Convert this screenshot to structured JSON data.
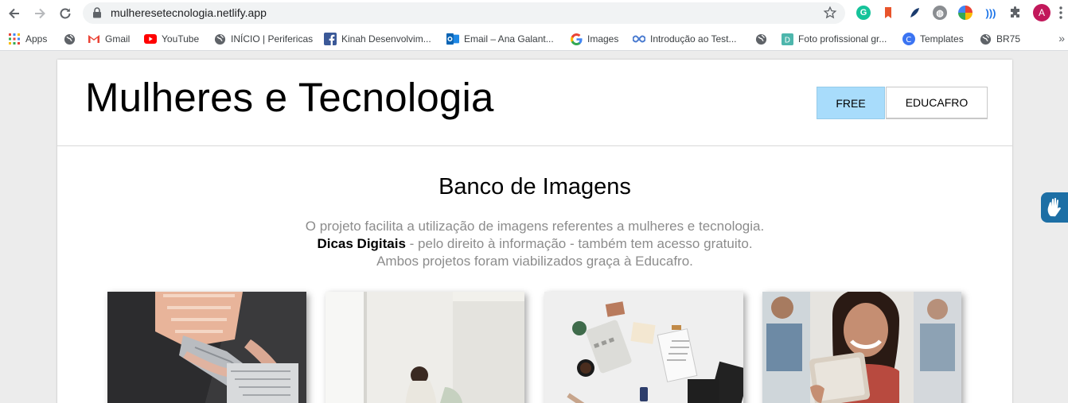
{
  "browser": {
    "url": "mulheresetecnologia.netlify.app",
    "profile_initial": "A",
    "bookmarks": [
      {
        "label": "Apps",
        "icon": "apps-grid-icon"
      },
      {
        "label": "",
        "icon": "globe-icon"
      },
      {
        "label": "Gmail",
        "icon": "gmail-icon"
      },
      {
        "label": "YouTube",
        "icon": "youtube-icon"
      },
      {
        "label": "INÍCIO | Perifericas",
        "icon": "globe-icon"
      },
      {
        "label": "Kinah Desenvolvim...",
        "icon": "facebook-icon"
      },
      {
        "label": "Email – Ana Galant...",
        "icon": "outlook-icon"
      },
      {
        "label": "Images",
        "icon": "google-icon"
      },
      {
        "label": "Introdução ao Test...",
        "icon": "infinity-icon"
      },
      {
        "label": "",
        "icon": "globe-icon"
      },
      {
        "label": "Foto profissional gr...",
        "icon": "doc-icon"
      },
      {
        "label": "Templates",
        "icon": "canva-icon"
      },
      {
        "label": "BR75",
        "icon": "globe-icon"
      }
    ],
    "more_bookmarks": "»"
  },
  "site": {
    "title": "Mulheres e Tecnologia",
    "nav": {
      "free": "FREE",
      "educafro": "EDUCAFRO"
    }
  },
  "main": {
    "heading": "Banco de Imagens",
    "line1": "O projeto facilita a utilização de imagens referentes a mulheres e tecnologia.",
    "line2_bold": "Dicas Digitais",
    "line2_rest": " - pelo direito à informação - também tem acesso gratuito.",
    "line3": "Ambos projetos foram viabilizados graça à Educafro."
  },
  "gallery": [
    {
      "name": "woman-typing-laptop-photo"
    },
    {
      "name": "woman-sitting-room-photo"
    },
    {
      "name": "office-desk-flatlay-photo"
    },
    {
      "name": "smiling-woman-tablet-photo"
    }
  ],
  "colors": {
    "free_button": "#a8dcfb",
    "a11y_widget": "#1d6fa5",
    "description_text": "#8c8c8c"
  }
}
